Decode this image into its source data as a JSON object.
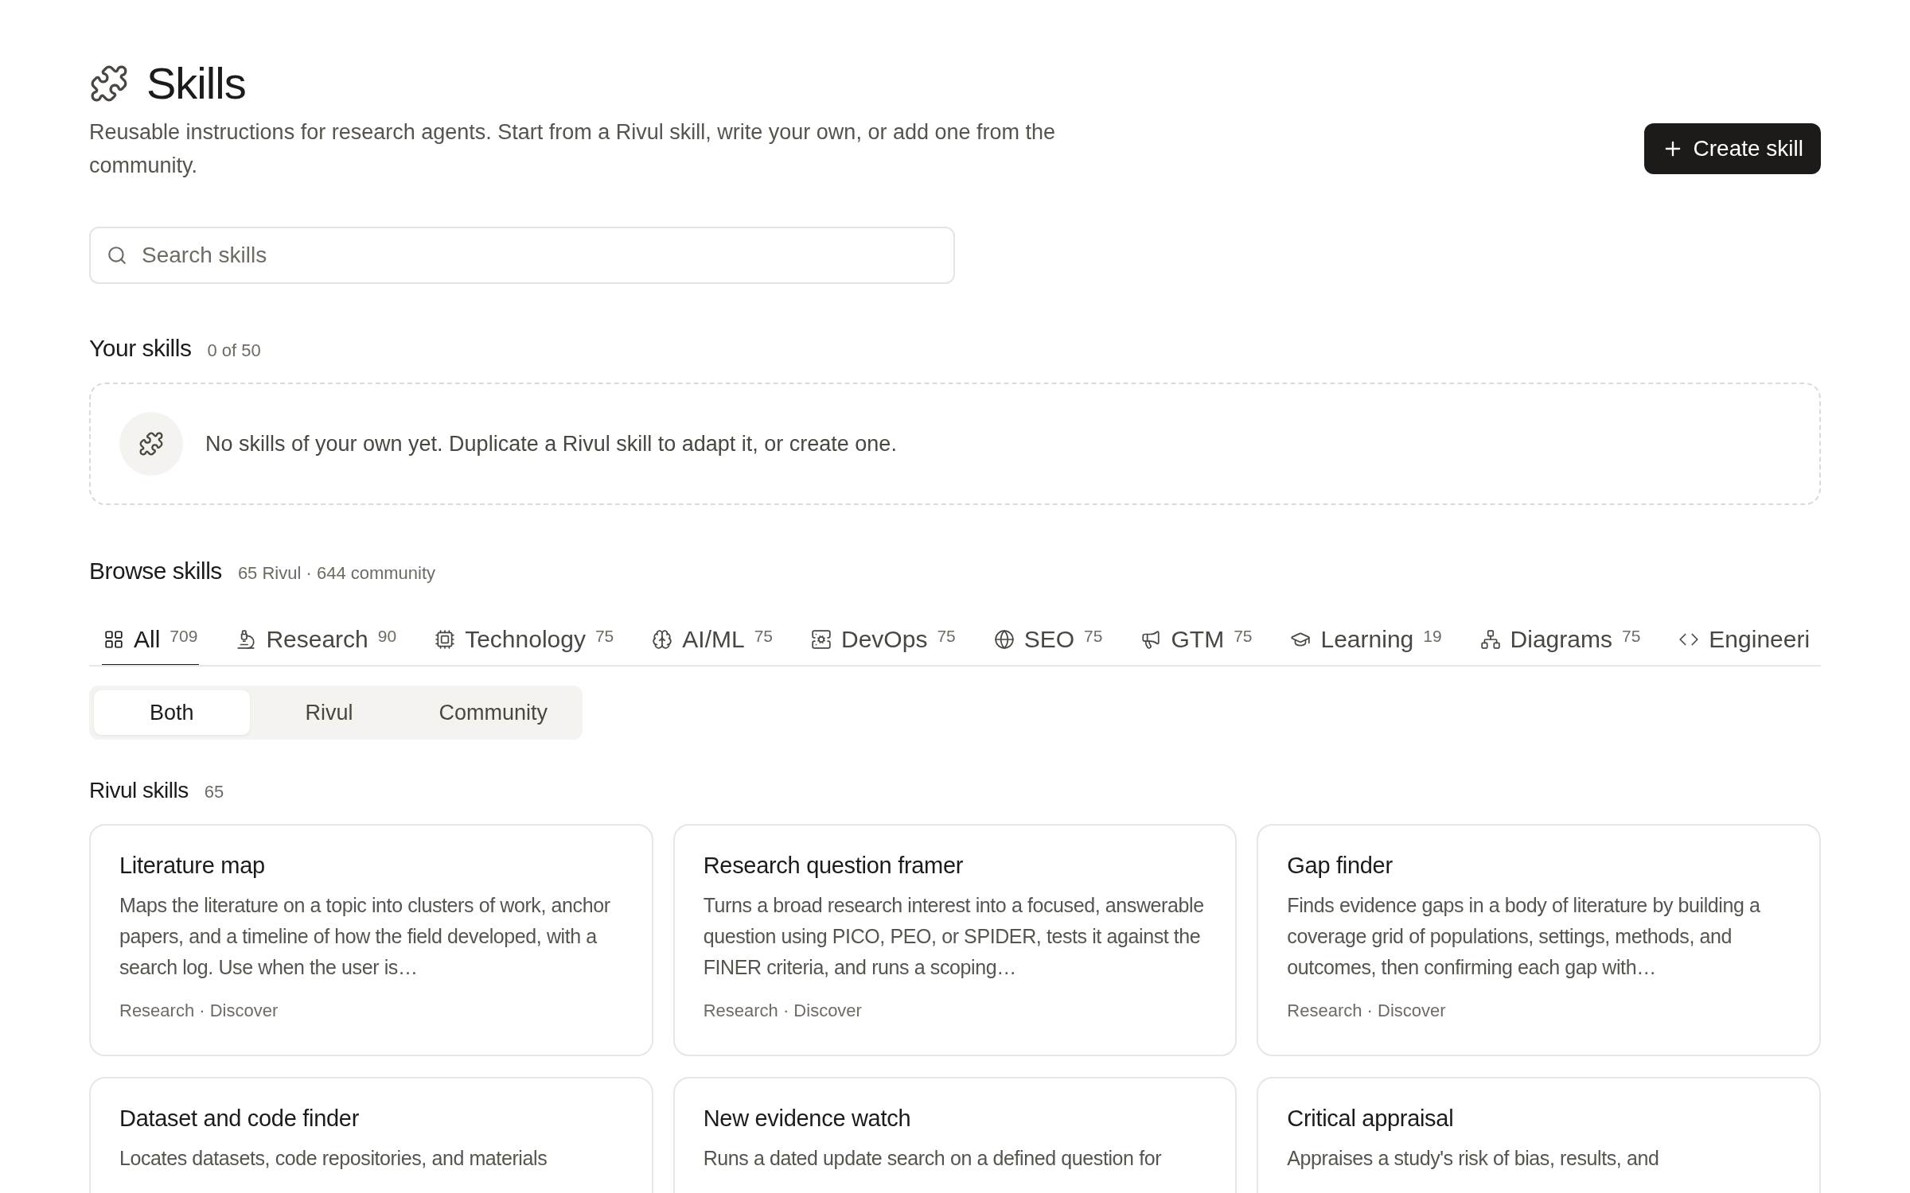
{
  "header": {
    "title": "Skills",
    "subtitle": "Reusable instructions for research agents. Start from a Rivul skill, write your own, or add one from the community.",
    "create_button": "Create skill"
  },
  "search": {
    "placeholder": "Search skills"
  },
  "your_skills": {
    "title": "Your skills",
    "count": "0 of 50",
    "empty_message": "No skills of your own yet. Duplicate a Rivul skill to adapt it, or create one."
  },
  "browse": {
    "title": "Browse skills",
    "summary": "65 Rivul · 644 community",
    "tabs": [
      {
        "kind": "grid",
        "label": "All",
        "count": "709",
        "selected": true
      },
      {
        "kind": "microscope",
        "label": "Research",
        "count": "90",
        "selected": false
      },
      {
        "kind": "chip",
        "label": "Technology",
        "count": "75",
        "selected": false
      },
      {
        "kind": "brain",
        "label": "AI/ML",
        "count": "75",
        "selected": false
      },
      {
        "kind": "server",
        "label": "DevOps",
        "count": "75",
        "selected": false
      },
      {
        "kind": "globe",
        "label": "SEO",
        "count": "75",
        "selected": false
      },
      {
        "kind": "megaphone",
        "label": "GTM",
        "count": "75",
        "selected": false
      },
      {
        "kind": "cap",
        "label": "Learning",
        "count": "19",
        "selected": false
      },
      {
        "kind": "network",
        "label": "Diagrams",
        "count": "75",
        "selected": false
      },
      {
        "kind": "code",
        "label": "Engineeri",
        "selected": false
      }
    ],
    "source_filter": [
      {
        "label": "Both",
        "selected": true
      },
      {
        "label": "Rivul",
        "selected": false
      },
      {
        "label": "Community",
        "selected": false
      }
    ]
  },
  "rivul_skills": {
    "title": "Rivul skills",
    "count": "65",
    "cards": [
      {
        "title": "Literature map",
        "description": "Maps the literature on a topic into clusters of work, anchor papers, and a timeline of how the field developed, with a search log. Use when the user is…",
        "tags": "Research · Discover"
      },
      {
        "title": "Research question framer",
        "description": "Turns a broad research interest into a focused, answerable question using PICO, PEO, or SPIDER, tests it against the FINER criteria, and runs a scoping…",
        "tags": "Research · Discover"
      },
      {
        "title": "Gap finder",
        "description": "Finds evidence gaps in a body of literature by building a coverage grid of populations, settings, methods, and outcomes, then confirming each gap with…",
        "tags": "Research · Discover"
      },
      {
        "title": "Dataset and code finder",
        "description": "Locates datasets, code repositories, and materials"
      },
      {
        "title": "New evidence watch",
        "description": "Runs a dated update search on a defined question for"
      },
      {
        "title": "Critical appraisal",
        "description": "Appraises a study's risk of bias, results, and"
      }
    ]
  }
}
